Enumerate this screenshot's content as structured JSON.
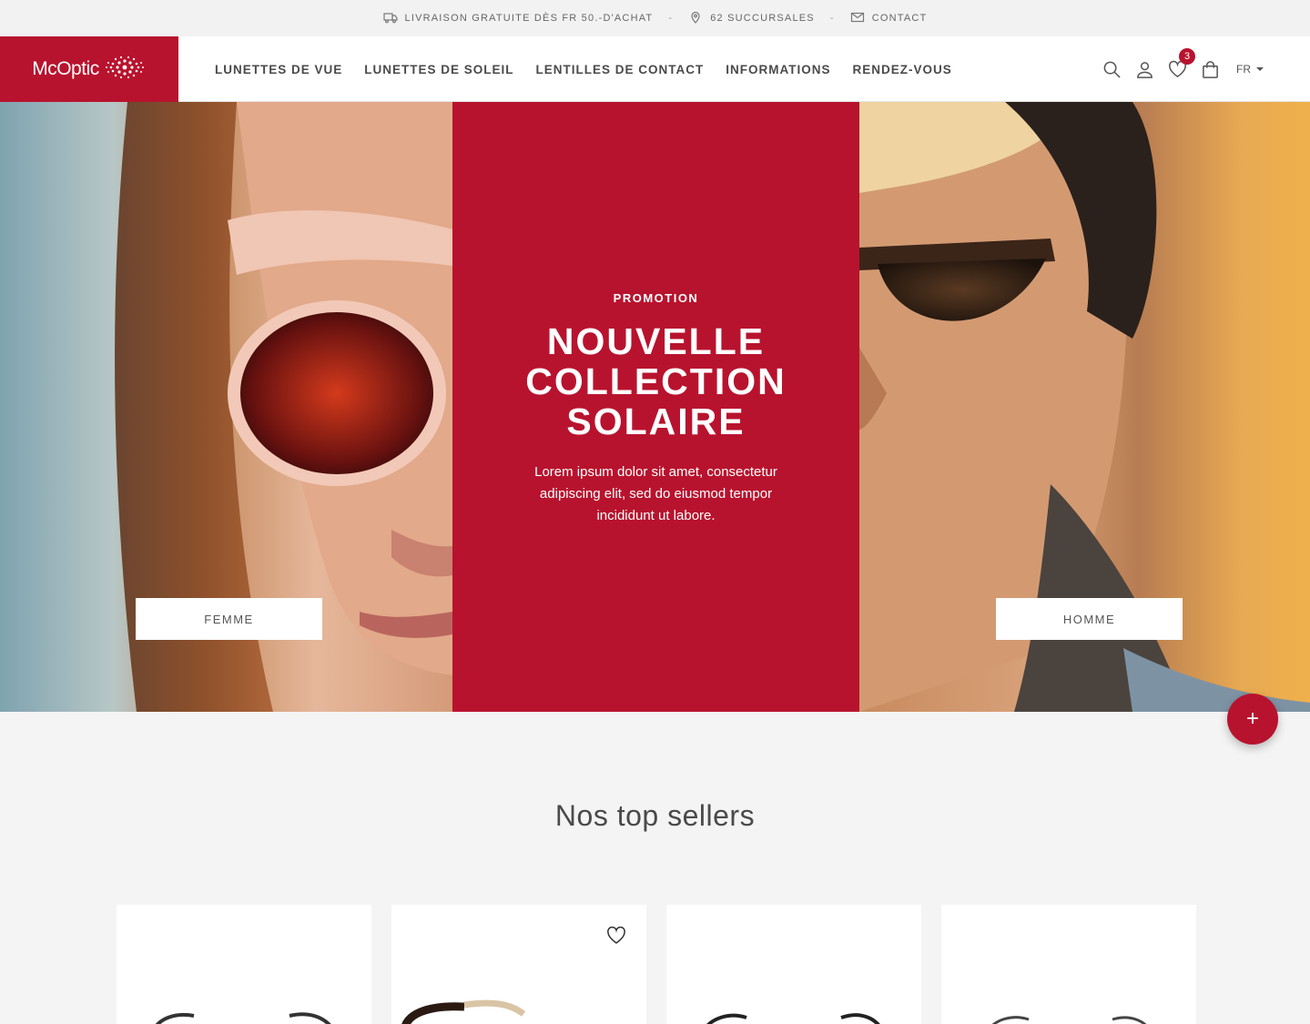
{
  "topbar": {
    "shipping": "LIVRAISON GRATUITE DÈS FR 50.-D'ACHAT",
    "branches": "62 SUCCURSALES",
    "contact": "CONTACT",
    "separator": "-"
  },
  "header": {
    "logo_text": "McOptic",
    "nav": [
      "LUNETTES DE VUE",
      "LUNETTES DE SOLEIL",
      "LENTILLES DE CONTACT",
      "INFORMATIONS",
      "RENDEZ-VOUS"
    ],
    "wishlist_count": "3",
    "language": "FR"
  },
  "hero": {
    "label": "PROMOTION",
    "title": "NOUVELLE COLLECTION SOLAIRE",
    "text": "Lorem ipsum dolor sit amet, consectetur adipiscing elit, sed do eiusmod tempor incididunt ut labore.",
    "button_left": "FEMME",
    "button_right": "HOMME"
  },
  "fab_label": "+",
  "section": {
    "title": "Nos top sellers"
  },
  "colors": {
    "brand": "#b8132e"
  },
  "icons": {
    "topbar": [
      "truck-icon",
      "location-pin-icon",
      "mail-icon"
    ],
    "header": [
      "search-icon",
      "user-icon",
      "heart-icon",
      "bag-icon"
    ]
  }
}
